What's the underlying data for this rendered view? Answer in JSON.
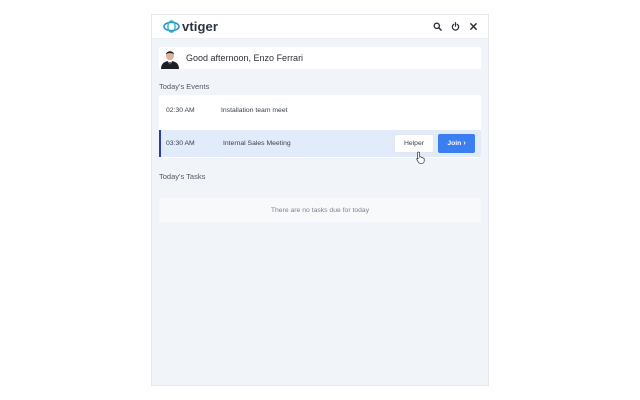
{
  "header": {
    "brand_name": "vtiger",
    "icons": [
      "search-icon",
      "power-icon",
      "close-icon"
    ]
  },
  "greeting": {
    "text": "Good afternoon, Enzo Ferrari"
  },
  "events": {
    "section_title": "Today's Events",
    "items": [
      {
        "time": "02:30 AM",
        "title": "Installation team meet"
      },
      {
        "time": "03:30 AM",
        "title": "Internal Sales Meeting",
        "helper_label": "Helper",
        "join_label": "Join"
      }
    ]
  },
  "tasks": {
    "section_title": "Today's Tasks",
    "empty_text": "There are no tasks due for today"
  },
  "colors": {
    "accent": "#3a7ef2",
    "active_row": "#e2ebfa",
    "active_border": "#2c3ea8",
    "panel_bg": "#f1f4f9"
  }
}
